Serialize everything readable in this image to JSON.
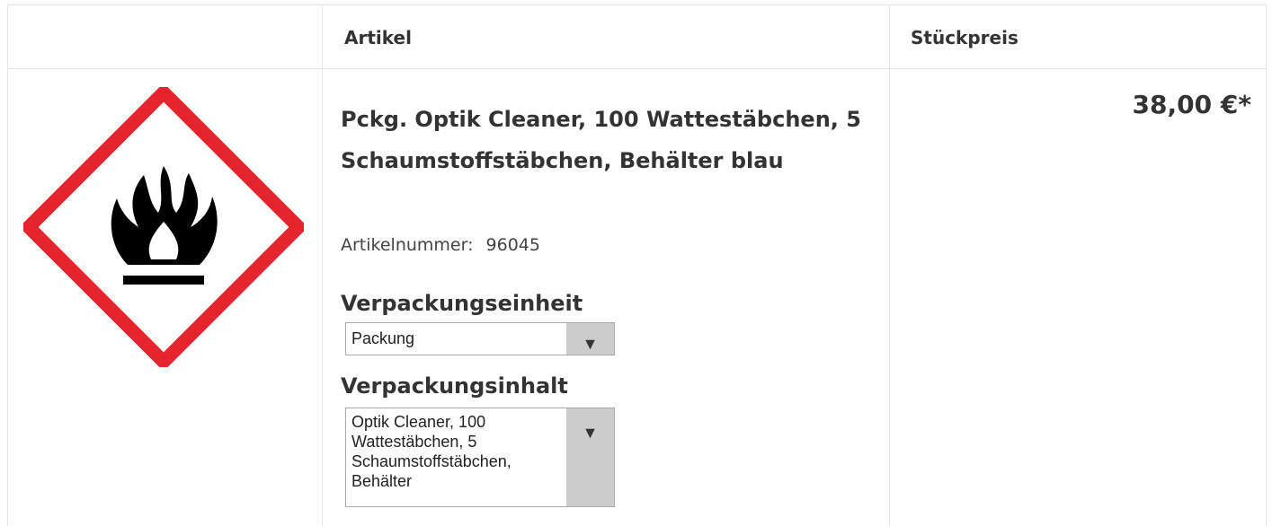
{
  "table_header": {
    "col_article": "Artikel",
    "col_unit_price": "Stückpreis"
  },
  "product": {
    "image_icon": "flammable-ghs-pictogram",
    "title": "Pckg. Optik Cleaner, 100 Wattestäbchen, 5 Schaumstoffstäbchen, Behälter blau",
    "article_number_label": "Artikelnummer:",
    "article_number": "96045",
    "price": "38,00 €*"
  },
  "packaging_unit": {
    "label": "Verpackungseinheit",
    "selected": "Packung"
  },
  "packaging_content": {
    "label": "Verpackungsinhalt",
    "selected": "Optik Cleaner, 100 Wattestäbchen, 5 Schaumstoffstäbchen, Behälter"
  },
  "colors": {
    "pictogram_border": "#e5242b",
    "select_button": "#cccccc",
    "grid_line": "#e6e6e6"
  }
}
